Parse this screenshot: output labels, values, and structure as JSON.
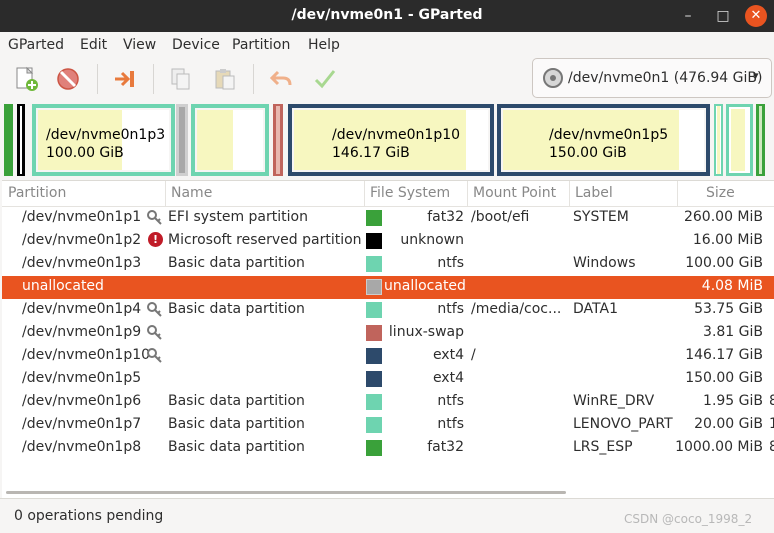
{
  "window": {
    "title": "/dev/nvme0n1 - GParted",
    "min": "–",
    "max": "□",
    "close": "✕"
  },
  "menu": [
    "GParted",
    "Edit",
    "View",
    "Device",
    "Partition",
    "Help"
  ],
  "device_selector": {
    "value": "/dev/nvme0n1 (476.94 GiB)",
    "arrow": "▾"
  },
  "graph": {
    "p3": {
      "name": "/dev/nvme0n1p3",
      "size": "100.00 GiB"
    },
    "p10": {
      "name": "/dev/nvme0n1p10",
      "size": "146.17 GiB"
    },
    "p5": {
      "name": "/dev/nvme0n1p5",
      "size": "150.00 GiB"
    }
  },
  "table": {
    "headers": [
      "Partition",
      "Name",
      "File System",
      "Mount Point",
      "Label",
      "Size"
    ],
    "rows": [
      {
        "partition": "/dev/nvme0n1p1",
        "icon": "key-icon",
        "name": "EFI system partition",
        "fs": "fat32",
        "fs_color": "#3aa13a",
        "mount": "/boot/efi",
        "label": "SYSTEM",
        "size": "260.00 MiB"
      },
      {
        "partition": "/dev/nvme0n1p2",
        "icon": "error-icon",
        "name": "Microsoft reserved partition",
        "fs": "unknown",
        "fs_color": "#000000",
        "mount": "",
        "label": "",
        "size": "16.00 MiB"
      },
      {
        "partition": "/dev/nvme0n1p3",
        "icon": "",
        "name": "Basic data partition",
        "fs": "ntfs",
        "fs_color": "#6ed4b0",
        "mount": "",
        "label": "Windows",
        "size": "100.00 GiB"
      },
      {
        "partition": "unallocated",
        "icon": "",
        "name": "",
        "fs": "unallocated",
        "fs_color": "#a8a8a8",
        "mount": "",
        "label": "",
        "size": "4.08 MiB"
      },
      {
        "partition": "/dev/nvme0n1p4",
        "icon": "key-icon",
        "name": "Basic data partition",
        "fs": "ntfs",
        "fs_color": "#6ed4b0",
        "mount": "/media/coc...",
        "label": "DATA1",
        "size": "53.75 GiB"
      },
      {
        "partition": "/dev/nvme0n1p9",
        "icon": "key-icon",
        "name": "",
        "fs": "linux-swap",
        "fs_color": "#c0645c",
        "mount": "",
        "label": "",
        "size": "3.81 GiB"
      },
      {
        "partition": "/dev/nvme0n1p10",
        "icon": "key-icon",
        "name": "",
        "fs": "ext4",
        "fs_color": "#2d4a6b",
        "mount": "/",
        "label": "",
        "size": "146.17 GiB"
      },
      {
        "partition": "/dev/nvme0n1p5",
        "icon": "",
        "name": "",
        "fs": "ext4",
        "fs_color": "#2d4a6b",
        "mount": "",
        "label": "",
        "size": "150.00 GiB"
      },
      {
        "partition": "/dev/nvme0n1p6",
        "icon": "",
        "name": "Basic data partition",
        "fs": "ntfs",
        "fs_color": "#6ed4b0",
        "mount": "",
        "label": "WinRE_DRV",
        "size": "1.95 GiB",
        "extra": "8"
      },
      {
        "partition": "/dev/nvme0n1p7",
        "icon": "",
        "name": "Basic data partition",
        "fs": "ntfs",
        "fs_color": "#6ed4b0",
        "mount": "",
        "label": "LENOVO_PART",
        "size": "20.00 GiB",
        "extra": "1"
      },
      {
        "partition": "/dev/nvme0n1p8",
        "icon": "",
        "name": "Basic data partition",
        "fs": "fat32",
        "fs_color": "#3aa13a",
        "mount": "",
        "label": "LRS_ESP",
        "size": "1000.00 MiB",
        "extra": "8"
      }
    ],
    "selected_index": 3
  },
  "status": {
    "text": "0 operations pending"
  },
  "watermark": "CSDN @coco_1998_2"
}
